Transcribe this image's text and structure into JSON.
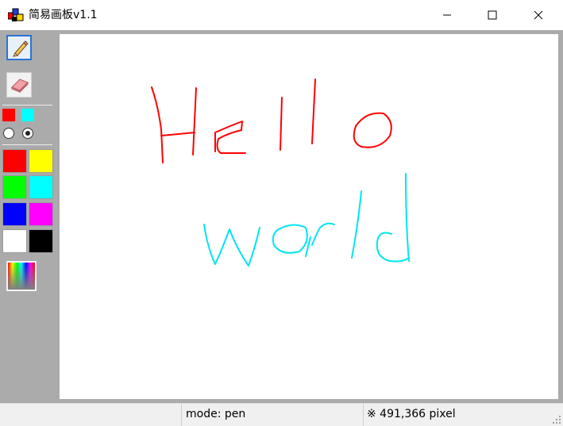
{
  "window": {
    "title": "简易画板v1.1"
  },
  "toolbar": {
    "tools": [
      {
        "name": "pen",
        "icon": "pencil-icon",
        "selected": true
      },
      {
        "name": "eraser",
        "icon": "eraser-icon",
        "selected": false
      }
    ],
    "current_colors": [
      "#ff0000",
      "#00ffff"
    ],
    "brush_sizes": [
      {
        "size": "small",
        "checked": false
      },
      {
        "size": "large",
        "checked": true
      }
    ],
    "palette": [
      "#ff0000",
      "#ffff00",
      "#00ff00",
      "#00ffff",
      "#0000ff",
      "#ff00ff",
      "#ffffff",
      "#000000"
    ],
    "custom_color_icon": "color-spectrum-icon"
  },
  "canvas": {
    "strokes": [
      {
        "text": "Hello",
        "color": "#ff0000"
      },
      {
        "text": "world",
        "color": "#00e5ee"
      }
    ]
  },
  "status": {
    "mode": "mode: pen",
    "coords": "※ 491,366 pixel"
  }
}
